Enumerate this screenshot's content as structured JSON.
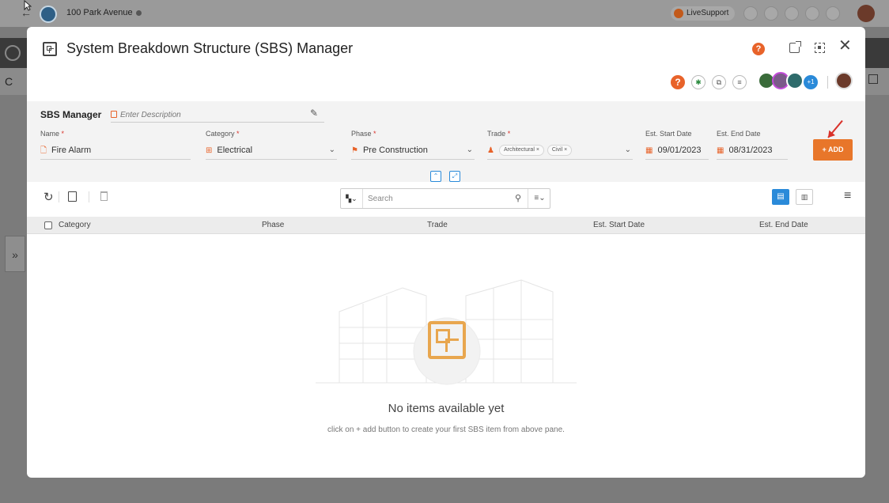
{
  "background": {
    "project_name": "100 Park Avenue",
    "live_support_label": "LiveSupport",
    "subbar_letter": "C",
    "side_toggle_glyph": "»"
  },
  "modal": {
    "title": "System Breakdown Structure (SBS) Manager",
    "help_glyph": "?",
    "close_glyph": "✕",
    "avatar_overflow": "+1"
  },
  "form": {
    "section_label": "SBS Manager",
    "description_placeholder": "Enter Description",
    "fields": {
      "name": {
        "label": "Name",
        "value": "Fire Alarm"
      },
      "category": {
        "label": "Category",
        "value": "Electrical"
      },
      "phase": {
        "label": "Phase",
        "value": "Pre Construction"
      },
      "trade": {
        "label": "Trade",
        "chips": [
          "Architectural ×",
          "Civil ×"
        ]
      },
      "start_date": {
        "label": "Est. Start Date",
        "value": "09/01/2023"
      },
      "end_date": {
        "label": "Est. End Date",
        "value": "08/31/2023"
      }
    },
    "required_mark": "*",
    "add_button": "+ ADD"
  },
  "grid": {
    "search_placeholder": "Search",
    "columns": [
      "Category",
      "Phase",
      "Trade",
      "Est. Start Date",
      "Est. End Date"
    ]
  },
  "empty_state": {
    "title": "No items available yet",
    "subtitle": "click on + add button to create your first SBS item from above pane."
  },
  "colors": {
    "accent_orange": "#e8762a",
    "accent_blue": "#2a8ad9",
    "required_red": "#d9322b"
  }
}
